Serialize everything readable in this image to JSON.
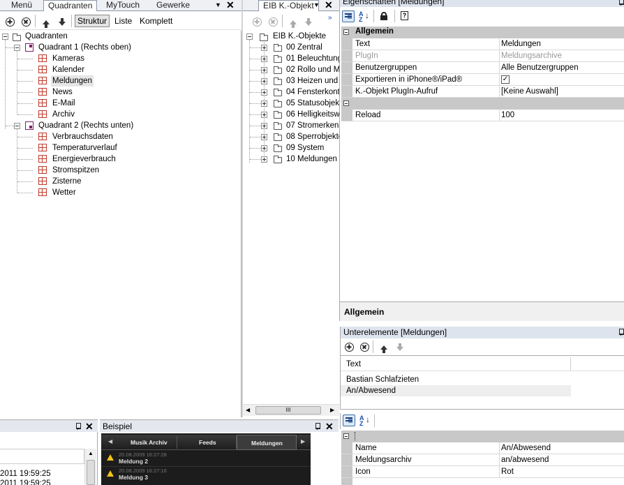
{
  "left_tabs": [
    "Menü",
    "Quadranten",
    "MyTouch",
    "Gewerke"
  ],
  "left_view_tabs": {
    "struktur": "Struktur",
    "liste": "Liste",
    "komplett": "Komplett"
  },
  "quadranten_tree": {
    "root": "Quadranten",
    "q1": {
      "label": "Quadrant 1 (Rechts oben)",
      "items": [
        "Kameras",
        "Kalender",
        "Meldungen",
        "News",
        "E-Mail",
        "Archiv"
      ]
    },
    "q2": {
      "label": "Quadrant 2 (Rechts unten)",
      "items": [
        "Verbrauchsdaten",
        "Temperaturverlauf",
        "Energieverbrauch",
        "Stromspitzen",
        "Zisterne",
        "Wetter"
      ]
    }
  },
  "eib_tab": "EIB K.-Objekt",
  "eib_tree": {
    "root": "EIB K.-Objekte",
    "items": [
      "00 Zentral",
      "01 Beleuchtung",
      "02 Rollo und M",
      "03 Heizen und",
      "04 Fensterkonta",
      "05 Statusobjekt",
      "06 Helligkeitswe",
      "07 Stromerkenn",
      "08 Sperrobjekte",
      "09 System",
      "10 Meldungen"
    ]
  },
  "properties": {
    "title": "Eigenschaften [Meldungen]",
    "category": "Allgemein",
    "rows": [
      {
        "key": "Text",
        "value": "Meldungen",
        "disabled": false
      },
      {
        "key": "PlugIn",
        "value": "Meldungsarchive",
        "disabled": true
      },
      {
        "key": "Benutzergruppen",
        "value": "Alle Benutzergruppen",
        "disabled": false
      },
      {
        "key": "Exportieren in iPhone®/iPad®",
        "value": "",
        "disabled": false
      },
      {
        "key": "K.-Objekt PlugIn-Aufruf",
        "value": "[Keine Auswahl]",
        "disabled": false
      }
    ],
    "reload_key": "Reload",
    "reload_value": "100",
    "description_title": "Allgemein"
  },
  "sub_elements": {
    "title": "Unterelemente [Meldungen]",
    "column": "Text",
    "rows": [
      "Bastian Schlafzieten",
      "An/Abwesend"
    ]
  },
  "sub_properties": {
    "rows": [
      {
        "key": "Name",
        "value": "An/Abwesend"
      },
      {
        "key": "Meldungsarchiv",
        "value": "an/abwesend"
      },
      {
        "key": "Icon",
        "value": "Rot"
      }
    ]
  },
  "log_panel": {
    "rows": [
      "2011 19:59:25",
      "2011 19:59:25"
    ]
  },
  "example_panel": {
    "title": "Beispiel",
    "tabs": [
      "Musik Archiv",
      "Feeds",
      "Meldungen"
    ],
    "messages": [
      {
        "date": "20.08.2009 16:27:28",
        "title": "Meldung 2"
      },
      {
        "date": "20.08.2009 16:27:16",
        "title": "Meldung 3"
      }
    ]
  },
  "colors": {
    "accent": "#1a4fb0",
    "panel_header": "#dde4ee",
    "category_bg": "#c8c8c8",
    "dark_example": "#1c1c1c"
  }
}
